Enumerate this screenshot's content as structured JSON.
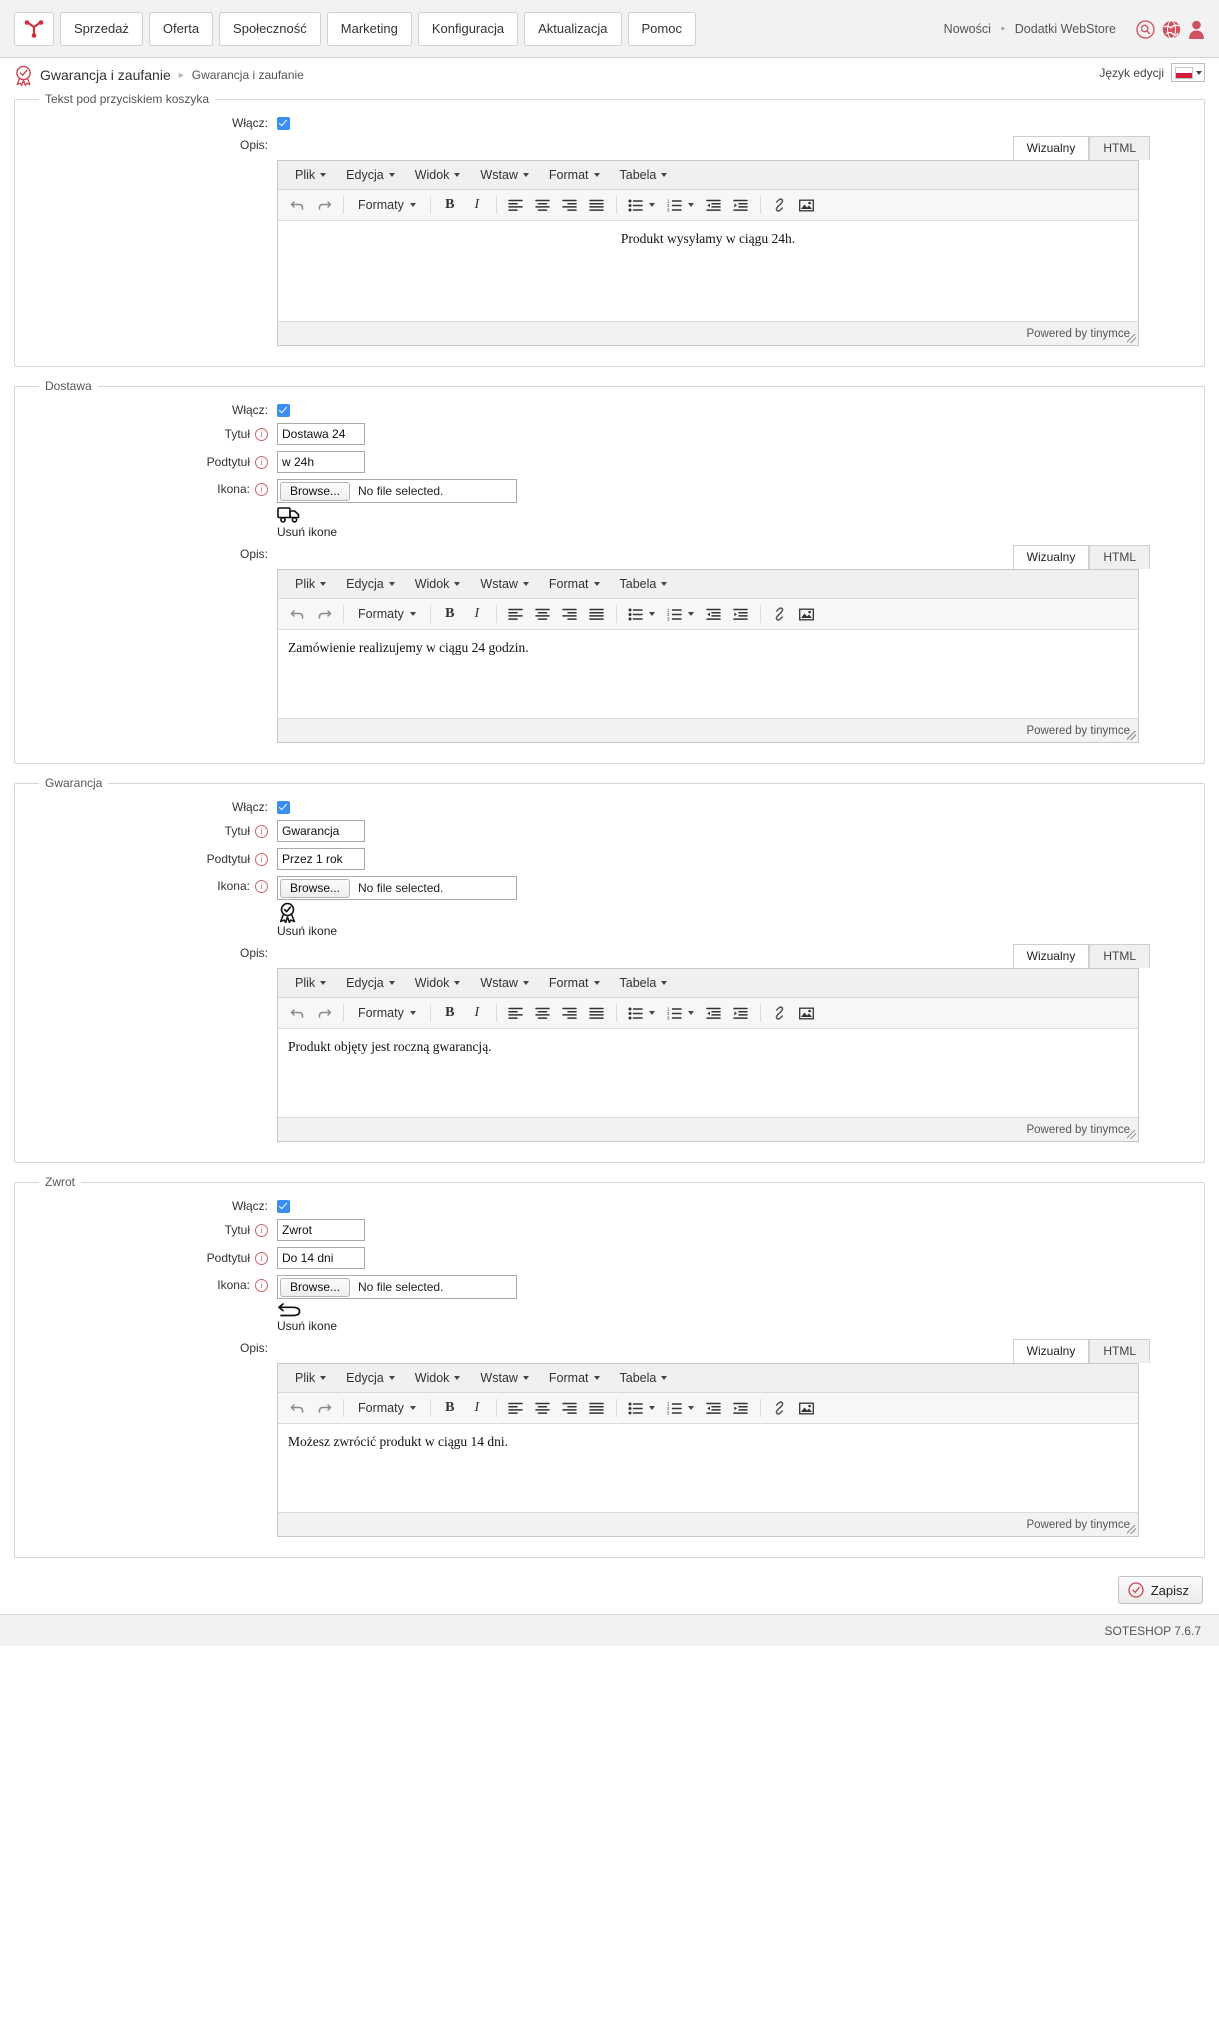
{
  "topnav": {
    "logo_icon": "soteshop-logo-icon",
    "items": [
      {
        "label": "Sprzedaż"
      },
      {
        "label": "Oferta"
      },
      {
        "label": "Społeczność"
      },
      {
        "label": "Marketing"
      },
      {
        "label": "Konfiguracja"
      },
      {
        "label": "Aktualizacja"
      },
      {
        "label": "Pomoc"
      }
    ],
    "news_label": "Nowości",
    "separator": "•",
    "webstore_label": "Dodatki WebStore",
    "icons": [
      "search-icon",
      "globe-icon",
      "user-icon"
    ]
  },
  "breadcrumb": {
    "icon": "badge-check-icon",
    "title": "Gwarancja i zaufanie",
    "separator": "▸",
    "sub": "Gwarancja i zaufanie",
    "lang_label": "Język edycji",
    "lang_flag": "pl"
  },
  "common": {
    "enable_label": "Włącz:",
    "title_label": "Tytuł",
    "subtitle_label": "Podtytuł",
    "icon_label": "Ikona:",
    "desc_label": "Opis:",
    "browse_label": "Browse...",
    "no_file_label": "No file selected.",
    "remove_icon_label": "Usuń ikone",
    "tab_visual": "Wizualny",
    "tab_html": "HTML",
    "powered_by": "Powered by tinymce",
    "info_char": "i",
    "menubar": [
      "Plik",
      "Edycja",
      "Widok",
      "Wstaw",
      "Format",
      "Tabela"
    ],
    "formats_label": "Formaty",
    "toolbar_icons": [
      "undo-icon",
      "redo-icon",
      "formats-dropdown",
      "bold-icon",
      "italic-icon",
      "align-left-icon",
      "align-center-icon",
      "align-right-icon",
      "align-justify-icon",
      "bullet-list-icon",
      "numbered-list-icon",
      "outdent-icon",
      "indent-icon",
      "link-icon",
      "image-icon"
    ]
  },
  "sections": [
    {
      "legend": "Tekst pod przyciskiem koszyka",
      "enabled": true,
      "has_fields": false,
      "desc_text": "Produkt wysyłamy w ciągu 24h.",
      "desc_align": "center",
      "icon_glyph": null
    },
    {
      "legend": "Dostawa",
      "enabled": true,
      "has_fields": true,
      "title_value": "Dostawa 24",
      "subtitle_value": "w 24h",
      "icon_glyph": "truck-icon",
      "desc_text": "Zamówienie realizujemy w ciągu 24 godzin.",
      "desc_align": "left"
    },
    {
      "legend": "Gwarancja",
      "enabled": true,
      "has_fields": true,
      "title_value": "Gwarancja",
      "subtitle_value": "Przez 1 rok",
      "icon_glyph": "award-check-icon",
      "desc_text": "Produkt objęty jest roczną gwarancją.",
      "desc_align": "left"
    },
    {
      "legend": "Zwrot",
      "enabled": true,
      "has_fields": true,
      "title_value": "Zwrot",
      "subtitle_value": "Do 14 dni",
      "icon_glyph": "return-arrow-icon",
      "desc_text": "Możesz zwrócić produkt w ciągu 14 dni.",
      "desc_align": "left"
    }
  ],
  "save": {
    "label": "Zapisz",
    "icon": "check-circle-icon"
  },
  "footer": {
    "version": "SOTESHOP 7.6.7"
  }
}
